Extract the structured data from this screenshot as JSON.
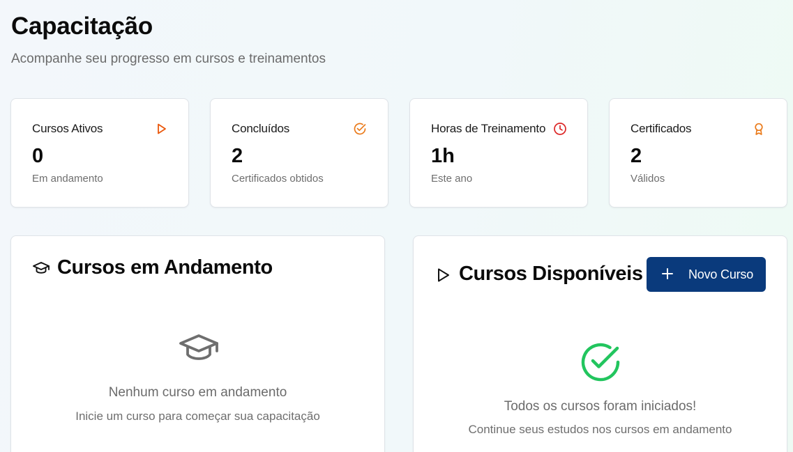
{
  "header": {
    "title": "Capacitação",
    "subtitle": "Acompanhe seu progresso em cursos e treinamentos"
  },
  "stats": [
    {
      "label": "Cursos Ativos",
      "value": "0",
      "hint": "Em andamento",
      "icon": "play-icon",
      "color": "#ea580c"
    },
    {
      "label": "Concluídos",
      "value": "2",
      "hint": "Certificados obtidos",
      "icon": "check-circle-icon",
      "color": "#ea7a1a"
    },
    {
      "label": "Horas de Treinamento",
      "value": "1h",
      "hint": "Este ano",
      "icon": "clock-icon",
      "color": "#dc2626"
    },
    {
      "label": "Certificados",
      "value": "2",
      "hint": "Válidos",
      "icon": "award-icon",
      "color": "#ea7a1a"
    }
  ],
  "in_progress": {
    "title": "Cursos em Andamento",
    "icon": "graduation-cap-icon",
    "empty_title": "Nenhum curso em andamento",
    "empty_sub": "Inicie um curso para começar sua capacitação"
  },
  "available": {
    "title": "Cursos Disponíveis",
    "icon": "play-outline-icon",
    "button_label": "Novo Curso",
    "empty_icon": "check-circle-icon",
    "empty_title": "Todos os cursos foram iniciados!",
    "empty_sub": "Continue seus estudos nos cursos em andamento",
    "accent": "#22c55e",
    "button_color": "#0a3a7c"
  }
}
